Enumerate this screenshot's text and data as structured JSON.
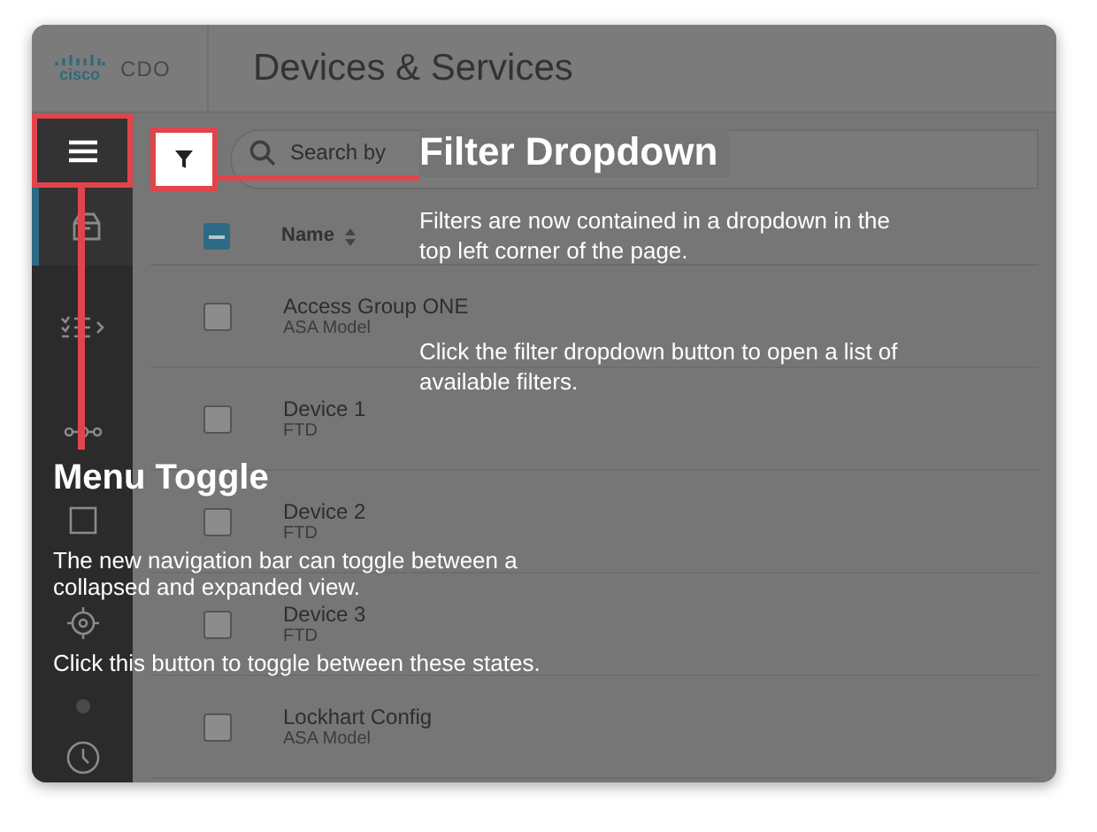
{
  "header": {
    "logo": "cisco",
    "product": "CDO",
    "title": "Devices & Services"
  },
  "sidebar": {
    "menu_toggle": {
      "highlighted": true
    },
    "items": [
      {
        "kind": "inventory",
        "selected": true
      },
      {
        "kind": "policies",
        "selected": false
      },
      {
        "kind": "objects",
        "selected": false
      },
      {
        "kind": "box",
        "selected": false
      },
      {
        "kind": "vpn",
        "selected": false
      },
      {
        "kind": "dot",
        "selected": false
      },
      {
        "kind": "history",
        "selected": false
      }
    ]
  },
  "toolbar": {
    "filter_button": {
      "highlighted": true
    },
    "search": {
      "placeholder": "Search by"
    }
  },
  "table": {
    "select_all": {
      "indeterminate": true
    },
    "columns": [
      "Name"
    ],
    "rows": [
      {
        "name": "Access Group ONE",
        "type": "ASA Model",
        "checked": false
      },
      {
        "name": "Device 1",
        "type": "FTD",
        "checked": false
      },
      {
        "name": "Device 2",
        "type": "FTD",
        "checked": false
      },
      {
        "name": "Device 3",
        "type": "FTD",
        "checked": false
      },
      {
        "name": "Lockhart Config",
        "type": "ASA Model",
        "checked": false
      }
    ]
  },
  "callouts": [
    {
      "kind": "filter",
      "title": "Filter Dropdown",
      "paragraphs": [
        "Filters are now contained in a dropdown in the top left corner of the page.",
        "Click the filter dropdown button to open a list of available filters."
      ]
    },
    {
      "kind": "menu",
      "title": "Menu Toggle",
      "paragraphs": [
        "The new navigation bar can toggle between a collapsed and expanded view.",
        "Click this button to toggle between these states."
      ]
    }
  ]
}
